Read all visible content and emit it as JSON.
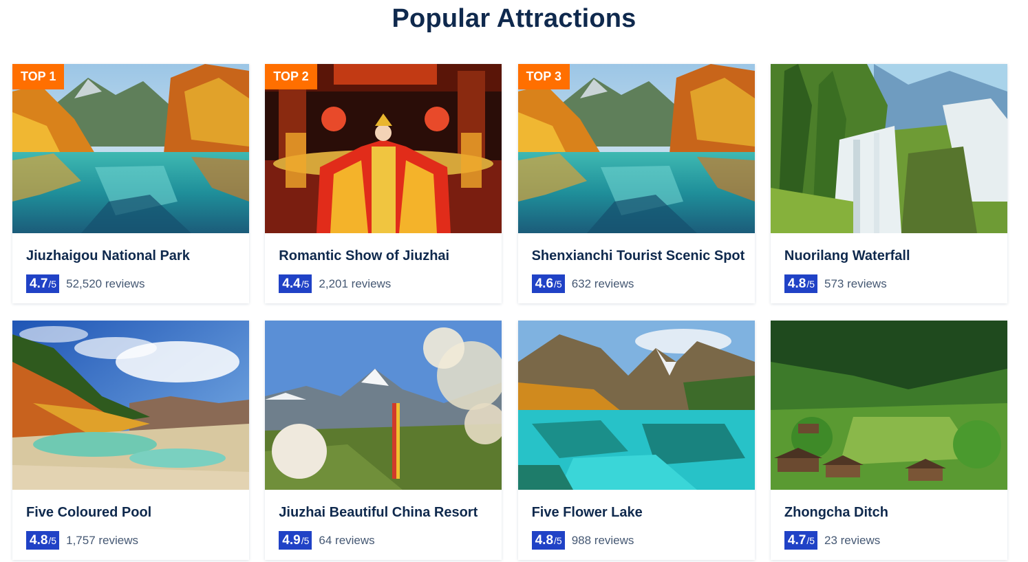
{
  "page": {
    "title": "Popular Attractions"
  },
  "colors": {
    "title": "#0f294d",
    "badge": "#ff6f00",
    "score_bg": "#2042c6",
    "review_text": "#455873"
  },
  "cards": [
    {
      "badge": "TOP 1",
      "name": "Jiuzhaigou National Park",
      "score": "4.7",
      "max": "/5",
      "reviews": "52,520 reviews",
      "image": "autumn-lake-mountains"
    },
    {
      "badge": "TOP 2",
      "name": "Romantic Show of Jiuzhai",
      "score": "4.4",
      "max": "/5",
      "reviews": "2,201 reviews",
      "image": "stage-performance"
    },
    {
      "badge": "TOP 3",
      "name": "Shenxianchi Tourist Scenic Spot",
      "score": "4.6",
      "max": "/5",
      "reviews": "632 reviews",
      "image": "autumn-lake-mountains"
    },
    {
      "badge": "",
      "name": "Nuorilang Waterfall",
      "score": "4.8",
      "max": "/5",
      "reviews": "573 reviews",
      "image": "forest-waterfall"
    },
    {
      "badge": "",
      "name": "Five Coloured Pool",
      "score": "4.8",
      "max": "/5",
      "reviews": "1,757 reviews",
      "image": "travertine-pools"
    },
    {
      "badge": "",
      "name": "Jiuzhai Beautiful China Resort",
      "score": "4.9",
      "max": "/5",
      "reviews": "64 reviews",
      "image": "snow-peak-blossoms"
    },
    {
      "badge": "",
      "name": "Five Flower Lake",
      "score": "4.8",
      "max": "/5",
      "reviews": "988 reviews",
      "image": "turquoise-lake"
    },
    {
      "badge": "",
      "name": "Zhongcha Ditch",
      "score": "4.7",
      "max": "/5",
      "reviews": "23 reviews",
      "image": "green-valley-village"
    }
  ]
}
